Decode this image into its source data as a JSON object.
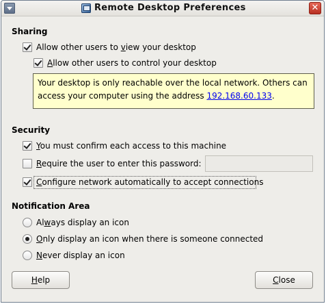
{
  "window": {
    "title": "Remote Desktop Preferences",
    "close_glyph": "✕"
  },
  "sharing": {
    "heading": "Sharing",
    "allow_view": {
      "mnemonic_before": "Allow other users to ",
      "mnemonic": "v",
      "mnemonic_after": "iew your desktop",
      "checked": true
    },
    "allow_control": {
      "mnemonic_before": "",
      "mnemonic": "A",
      "mnemonic_after": "llow other users to control your desktop",
      "checked": true
    },
    "info": {
      "line1": "Your desktop is only reachable over the local network. Others can",
      "line2_prefix": "access your computer using the address ",
      "address": "192.168.60.133",
      "line2_suffix": "."
    }
  },
  "security": {
    "heading": "Security",
    "confirm_access": {
      "mnemonic_before": "",
      "mnemonic": "Y",
      "mnemonic_after": "ou must confirm each access to this machine",
      "checked": true
    },
    "require_password": {
      "mnemonic_before": "",
      "mnemonic": "R",
      "mnemonic_after": "equire the user to enter this password:",
      "checked": false,
      "value": ""
    },
    "configure_network": {
      "mnemonic_before": "",
      "mnemonic": "C",
      "mnemonic_after": "onfigure network automatically to accept connections",
      "checked": true
    }
  },
  "notification": {
    "heading": "Notification Area",
    "options": [
      {
        "mnemonic_before": "Al",
        "mnemonic": "w",
        "mnemonic_after": "ays display an icon",
        "selected": false
      },
      {
        "mnemonic_before": "",
        "mnemonic": "O",
        "mnemonic_after": "nly display an icon when there is someone connected",
        "selected": true
      },
      {
        "mnemonic_before": "",
        "mnemonic": "N",
        "mnemonic_after": "ever display an icon",
        "selected": false
      }
    ]
  },
  "buttons": {
    "help": {
      "mnemonic_before": "",
      "mnemonic": "H",
      "mnemonic_after": "elp"
    },
    "close": {
      "mnemonic_before": "",
      "mnemonic": "C",
      "mnemonic_after": "lose"
    }
  },
  "colors": {
    "info_background": "#ffffcc",
    "link": "#0000ee",
    "window_background": "#eeede9"
  }
}
